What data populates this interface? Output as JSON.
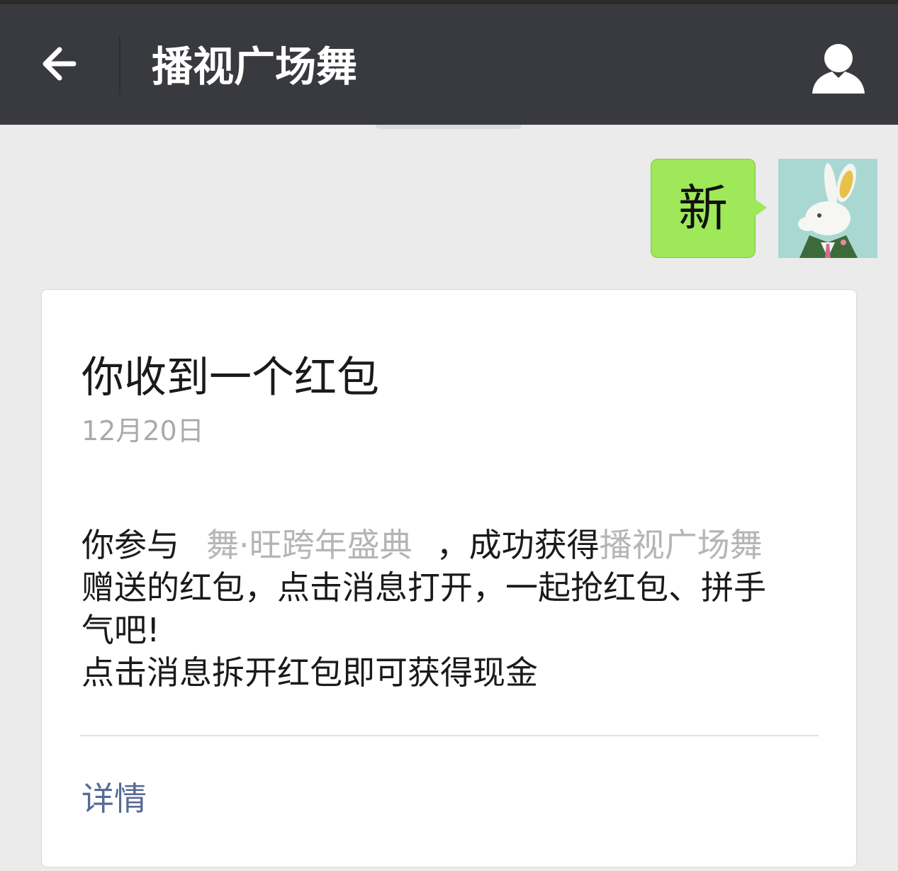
{
  "header": {
    "title": "播视广场舞",
    "back_icon": "arrow-left-icon",
    "profile_icon": "person-icon",
    "background": "#393a3f"
  },
  "message": {
    "text": "新",
    "bubble_color": "#9ee859",
    "avatar": "rabbit-avatar"
  },
  "card": {
    "title": "你收到一个红包",
    "date": "12月20日",
    "body": {
      "l1_a": "你参与",
      "l1_event": "舞·旺跨年盛典",
      "l1_b": "，成功获得",
      "l1_sender": "播视广场舞",
      "l2": "赠送的红包，点击消息打开，一起抢红包、拼手",
      "l3": "气吧!",
      "l4": "点击消息拆开红包即可获得现金"
    },
    "detail_link": "详情",
    "link_color": "#576b95"
  }
}
